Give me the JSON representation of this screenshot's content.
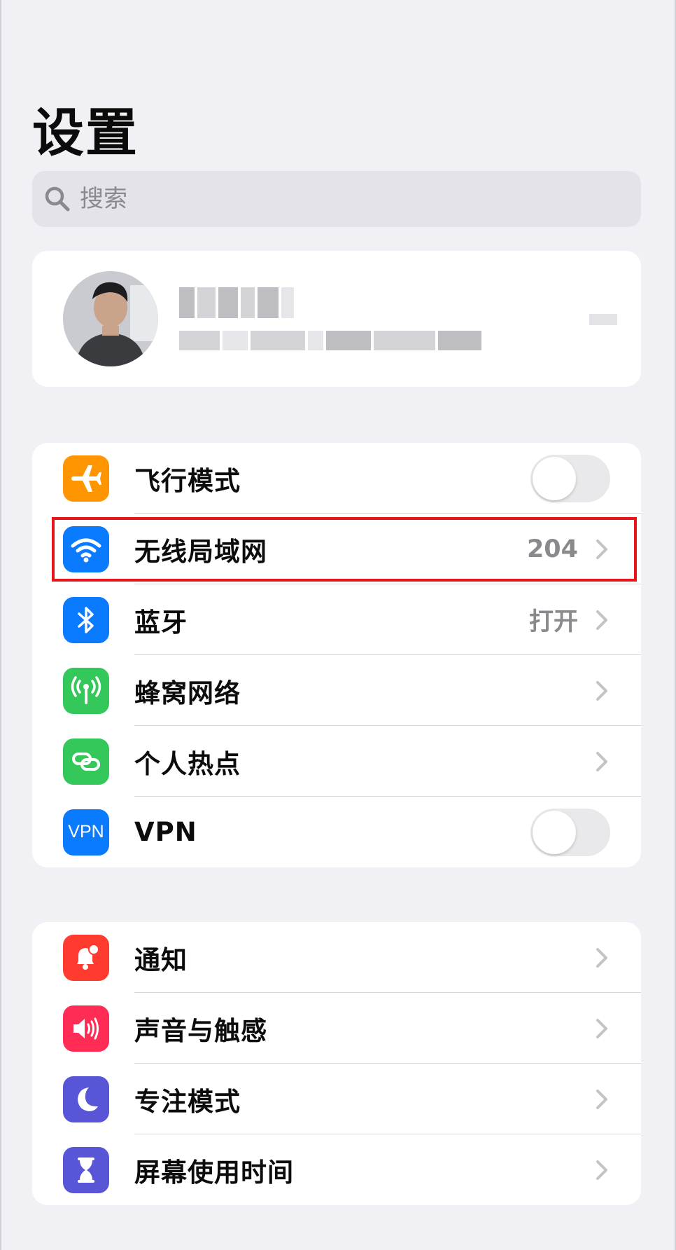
{
  "page": {
    "title": "设置"
  },
  "search": {
    "placeholder": "搜索"
  },
  "profile": {
    "name": "[blurred]",
    "subtitle": "[blurred]"
  },
  "connectivity": [
    {
      "label": "飞行模式",
      "type": "toggle",
      "on": false,
      "icon": "airplane-icon",
      "color": "#ff9500"
    },
    {
      "label": "无线局域网",
      "type": "link",
      "value": "204",
      "icon": "wifi-icon",
      "color": "#0a7aff"
    },
    {
      "label": "蓝牙",
      "type": "link",
      "value": "打开",
      "icon": "bluetooth-icon",
      "color": "#0a7aff"
    },
    {
      "label": "蜂窝网络",
      "type": "link",
      "icon": "cellular-icon",
      "color": "#34c759"
    },
    {
      "label": "个人热点",
      "type": "link",
      "icon": "hotspot-icon",
      "color": "#34c759"
    },
    {
      "label": "VPN",
      "type": "toggle",
      "on": false,
      "icon": "vpn-icon",
      "icon_text": "VPN",
      "color": "#0a7aff"
    }
  ],
  "general": [
    {
      "label": "通知",
      "icon": "notification-bell-icon",
      "color": "#ff3b30"
    },
    {
      "label": "声音与触感",
      "icon": "speaker-icon",
      "color": "#ff2d55"
    },
    {
      "label": "专注模式",
      "icon": "moon-icon",
      "color": "#5856d6"
    },
    {
      "label": "屏幕使用时间",
      "icon": "hourglass-icon",
      "color": "#5856d6"
    }
  ],
  "highlight_target": "无线局域网"
}
